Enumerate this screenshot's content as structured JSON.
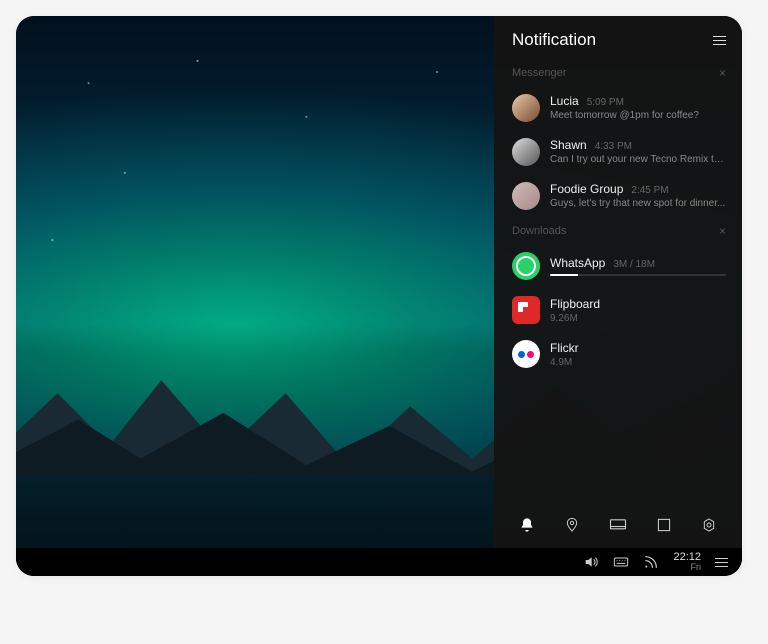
{
  "panel": {
    "title": "Notification",
    "sections": {
      "messenger": {
        "label": "Messenger"
      },
      "downloads": {
        "label": "Downloads"
      }
    }
  },
  "messages": [
    {
      "name": "Lucia",
      "time": "5:09 PM",
      "text": "Meet tomorrow @1pm for coffee?"
    },
    {
      "name": "Shawn",
      "time": "4:33 PM",
      "text": "Can I try out your new Tecno Remix tab..."
    },
    {
      "name": "Foodie Group",
      "time": "2:45 PM",
      "text": "Guys, let's try that new spot for dinner..."
    }
  ],
  "downloads": [
    {
      "name": "WhatsApp",
      "meta": "3M / 18M",
      "progress": 16
    },
    {
      "name": "Flipboard",
      "size": "9.26M"
    },
    {
      "name": "Flickr",
      "size": "4.9M"
    }
  ],
  "taskbar": {
    "time": "22:12",
    "day": "Fri"
  }
}
